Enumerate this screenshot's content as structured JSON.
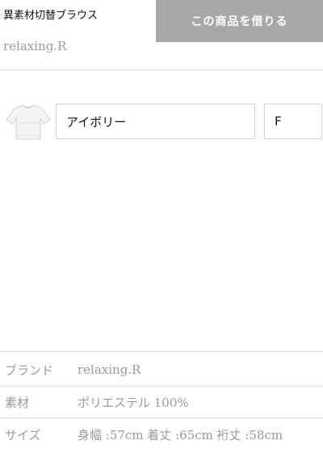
{
  "product": {
    "title": "異素材切替ブラウス",
    "brand": "relaxing.R",
    "rent_button": "この商品を借りる"
  },
  "options": {
    "color": "アイボリー",
    "size": "F"
  },
  "specs": [
    {
      "key": "ブランド",
      "value": "relaxing.R"
    },
    {
      "key": "素材",
      "value": "ポリエステル 100%"
    },
    {
      "key": "サイズ",
      "value": "身幅 :57cm 着丈 :65cm 裄丈 :58cm"
    }
  ],
  "icons": {
    "thumbnail": "blouse-thumbnail-icon"
  }
}
